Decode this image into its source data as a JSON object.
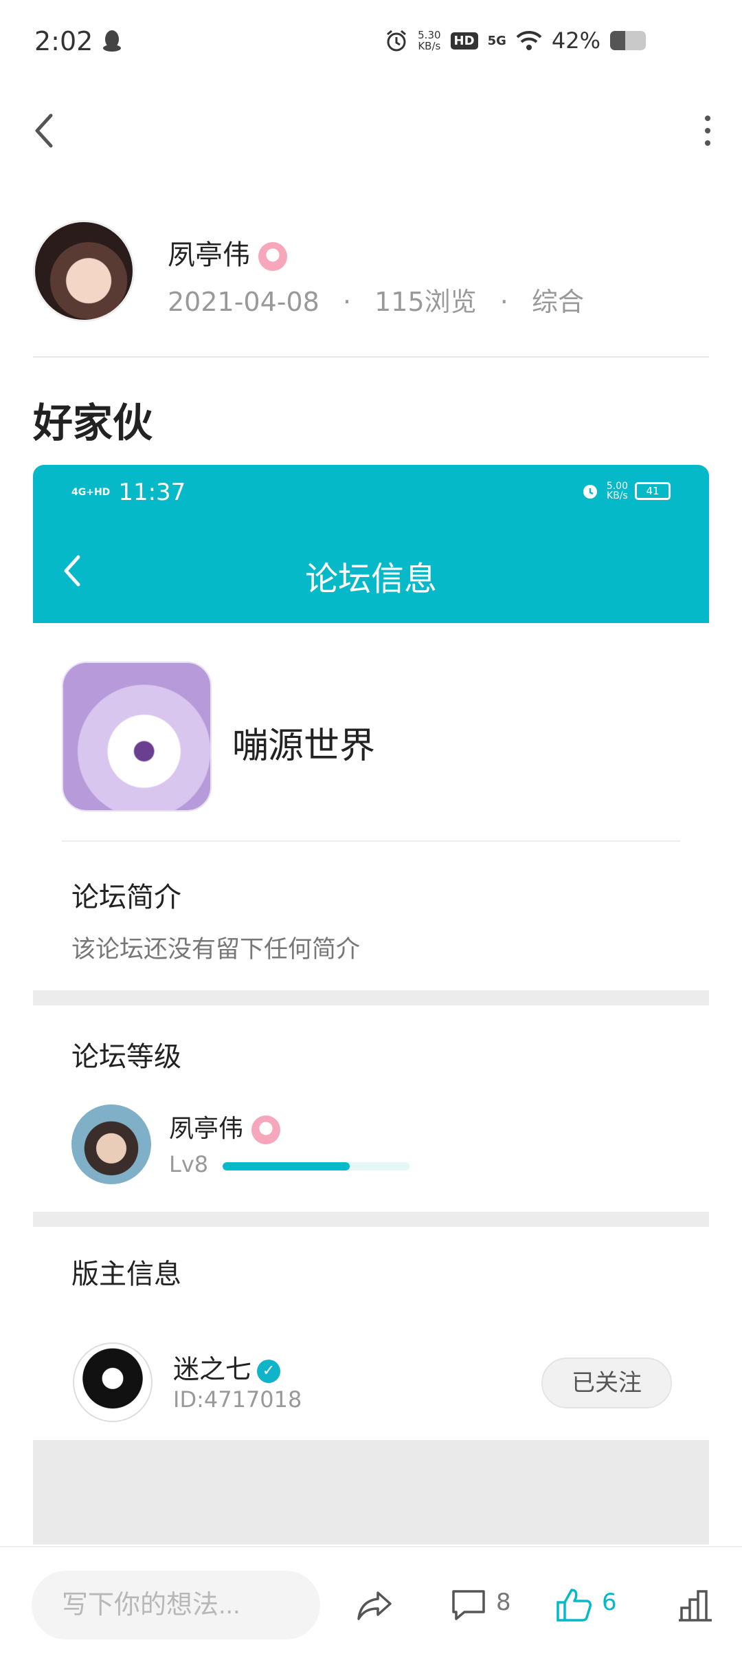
{
  "status_bar": {
    "time": "2:02",
    "net_speed_value": "5.30",
    "net_speed_unit": "KB/s",
    "hd": "HD",
    "network": "5G",
    "battery_text": "42%",
    "battery_level": 0.42
  },
  "author": {
    "name": "夙亭伟",
    "date": "2021-04-08",
    "views": "115浏览",
    "category": "综合",
    "separator": "·"
  },
  "post": {
    "title": "好家伙"
  },
  "embedded": {
    "status_time": "11:37",
    "status_signal": "4G+HD",
    "status_speed_value": "5.00",
    "status_speed_unit": "KB/s",
    "status_battery": "41",
    "header_title": "论坛信息",
    "forum_name": "嘣源世界",
    "intro_title": "论坛简介",
    "intro_text": "该论坛还没有留下任何简介",
    "level_title": "论坛等级",
    "level_user_name": "夙亭伟",
    "level_label": "Lv8",
    "level_progress": 0.68,
    "moderator_title": "版主信息",
    "moderator_name": "迷之七",
    "moderator_id": "ID:4717018",
    "follow_label": "已关注"
  },
  "bottom_bar": {
    "placeholder": "写下你的想法...",
    "comment_count": "8",
    "like_count": "6",
    "like_color": "#05b9c8"
  },
  "colors": {
    "accent": "#05b9c8",
    "text_primary": "#222222",
    "text_secondary": "#999999"
  }
}
